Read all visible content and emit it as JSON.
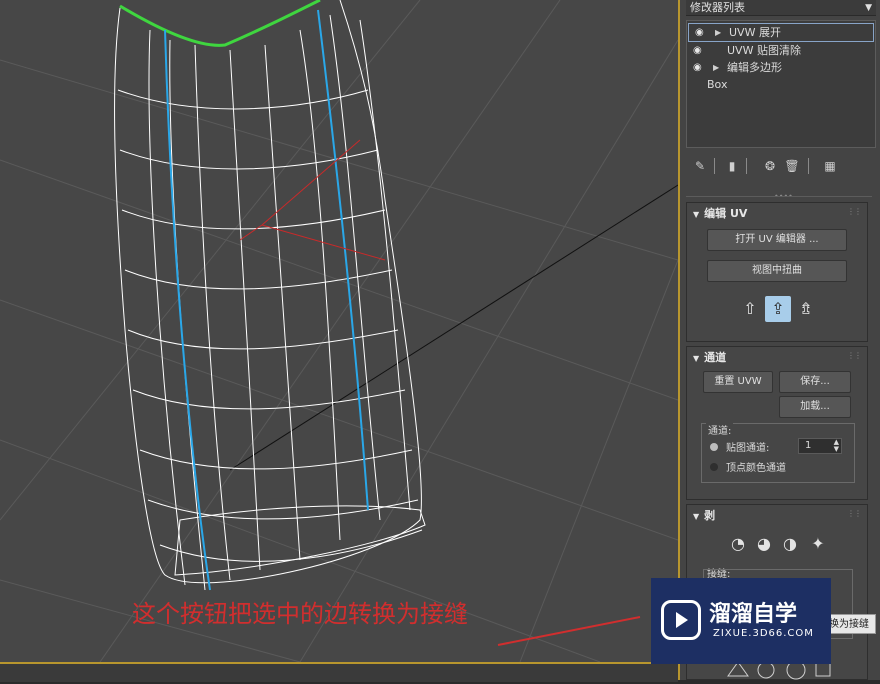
{
  "modifier_list": {
    "label": "修改器列表"
  },
  "modifier_stack": [
    {
      "label": "UVW 展开",
      "has_eye": true,
      "expandable": true,
      "selected": true
    },
    {
      "label": "UVW 贴图清除",
      "has_eye": true,
      "expandable": false,
      "selected": false
    },
    {
      "label": "编辑多边形",
      "has_eye": true,
      "expandable": true,
      "selected": false
    },
    {
      "label": "Box",
      "has_eye": false,
      "expandable": false,
      "selected": false
    }
  ],
  "stack_toolbar": [
    "pin-icon",
    "show-end-result-icon",
    "make-unique-icon",
    "remove-modifier-icon",
    "configure-sets-icon"
  ],
  "edit_uv": {
    "title": "编辑 UV",
    "open_editor_label": "打开 UV 编辑器 ...",
    "tweak_label": "视图中扭曲"
  },
  "channel": {
    "title": "通道",
    "reset_label": "重置 UVW",
    "save_label": "保存...",
    "load_label": "加载...",
    "group_label": "通道:",
    "map_channel_label": "贴图通道:",
    "map_channel_value": "1",
    "vertex_color_label": "顶点颜色通道"
  },
  "peel": {
    "title": "剥",
    "seams_label": "接缝:"
  },
  "annotation": "这个按钮把选中的边转换为接缝",
  "watermark": {
    "title": "溜溜自学",
    "subtitle": "ZIXUE.3D66.COM"
  },
  "tooltip": "换为接缝",
  "colors": {
    "viewport_bg": "#474747",
    "wireframe": "#ffffff",
    "seam_blue": "#2aa7e8",
    "seam_green": "#3fd63f",
    "annotation_red": "#d12e2e",
    "panel_border": "#b8962e"
  }
}
